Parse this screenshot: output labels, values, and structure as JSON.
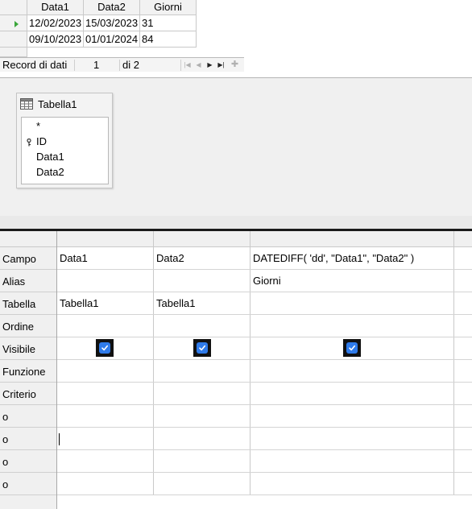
{
  "result_grid": {
    "columns": [
      "Data1",
      "Data2",
      "Giorni"
    ],
    "rows": [
      [
        "12/02/2023",
        "15/03/2023",
        "31"
      ],
      [
        "09/10/2023",
        "01/01/2024",
        "84"
      ]
    ]
  },
  "record_nav": {
    "label": "Record di dati",
    "current": "1",
    "of_text": "di 2"
  },
  "design": {
    "table_name": "Tabella1",
    "fields": [
      "*",
      "ID",
      "Data1",
      "Data2"
    ]
  },
  "query_grid": {
    "row_labels": [
      "Campo",
      "Alias",
      "Tabella",
      "Ordine",
      "Visibile",
      "Funzione",
      "Criterio",
      "o",
      "o",
      "o",
      "o"
    ],
    "columns": [
      {
        "campo": "Data1",
        "alias": "",
        "tabella": "Tabella1",
        "visible": true
      },
      {
        "campo": "Data2",
        "alias": "",
        "tabella": "Tabella1",
        "visible": true
      },
      {
        "campo": "DATEDIFF( 'dd', \"Data1\", \"Data2\" )",
        "alias": "Giorni",
        "tabella": "",
        "visible": true
      }
    ]
  },
  "colors": {
    "checkbox": "#2f7bea",
    "current_row_arrow": "#3aa63a"
  },
  "icons": [
    "current-row-arrow-icon",
    "table-icon",
    "primary-key-icon",
    "checkmark-icon",
    "nav-first-icon",
    "nav-prev-icon",
    "nav-next-icon",
    "nav-last-icon",
    "nav-new-icon"
  ]
}
